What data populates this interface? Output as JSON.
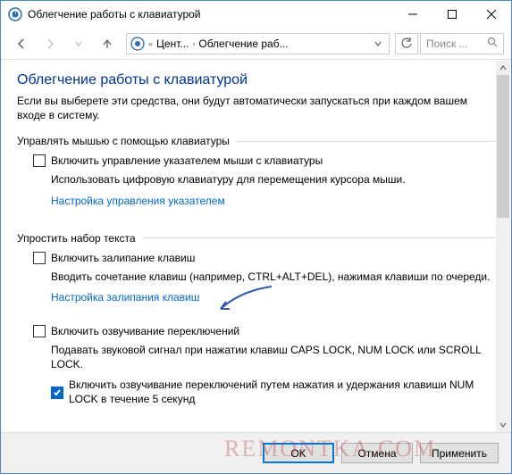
{
  "window": {
    "title": "Облегчение работы с клавиатурой"
  },
  "address": {
    "seg1": "Цент...",
    "seg2": "Облегчение раб..."
  },
  "search": {
    "placeholder": "Поиск ..."
  },
  "page": {
    "heading": "Облегчение работы с клавиатурой",
    "intro": "Если вы выберете эти средства, они будут автоматически запускаться при каждом вашем входе в систему."
  },
  "sec1": {
    "legend": "Управлять мышью с помощью клавиатуры",
    "chk1_label": "Включить управление указателем мыши с клавиатуры",
    "desc1": "Использовать цифровую клавиатуру для перемещения курсора мыши.",
    "link1": "Настройка управления указателем"
  },
  "sec2": {
    "legend": "Упростить набор текста",
    "chk1_label": "Включить залипание клавиш",
    "desc1": "Вводить сочетание клавиш (например, CTRL+ALT+DEL), нажимая клавиши по очереди.",
    "link1": "Настройка залипания клавиш",
    "chk2_label": "Включить озвучивание переключений",
    "desc2": "Подавать звуковой сигнал при нажатии клавиш CAPS LOCK, NUM LOCK или SCROLL LOCK.",
    "chk3_label": "Включить озвучивание переключений путем нажатия и удержания клавиши NUM LOCK в течение 5 секунд"
  },
  "buttons": {
    "ok": "OK",
    "cancel": "Отмена",
    "apply": "Применить"
  },
  "watermark": "REMONTKA.COM"
}
